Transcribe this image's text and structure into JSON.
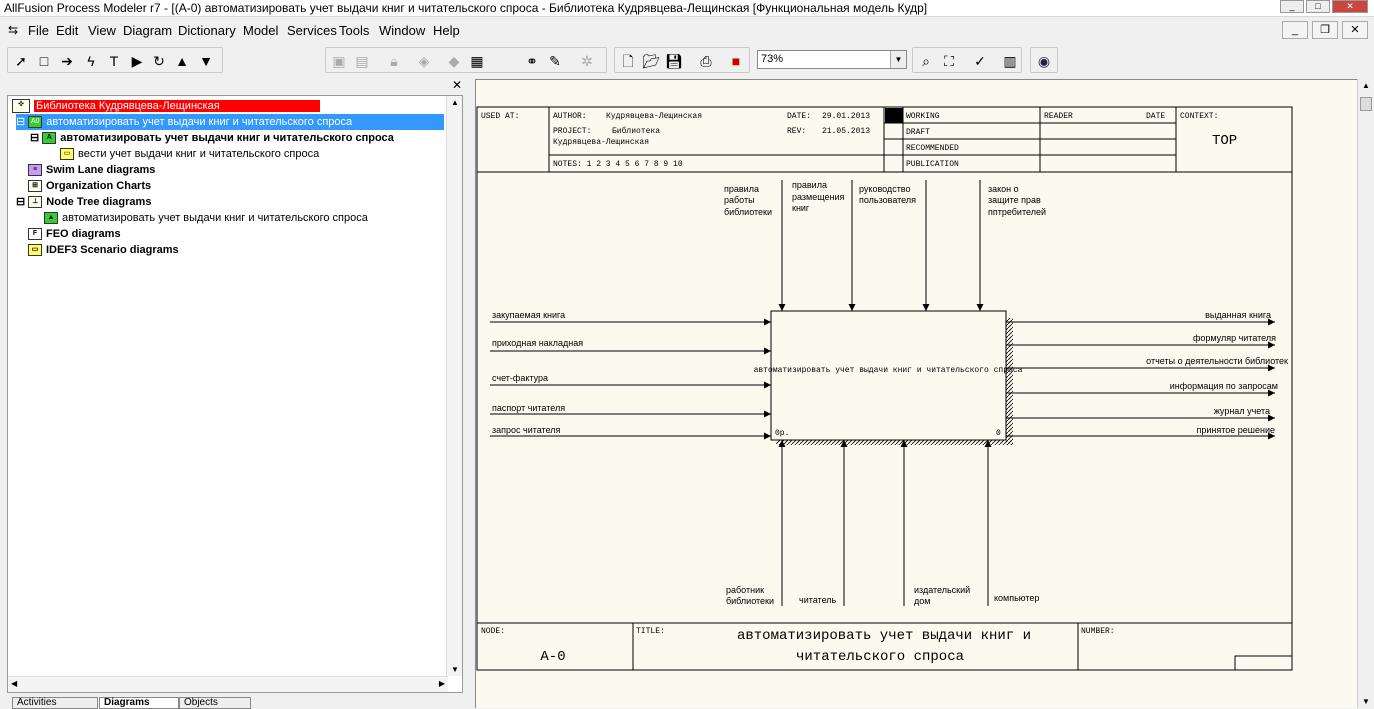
{
  "window": {
    "title": "AllFusion Process Modeler r7 - [(A-0) автоматизировать учет выдачи книг и читательского спроса - Библиотека Кудрявцева-Лещинская  [Функциональная модель Кудр]"
  },
  "menu": [
    "File",
    "Edit",
    "View",
    "Diagram",
    "Dictionary",
    "Model",
    "Services",
    "Tools",
    "Window",
    "Help"
  ],
  "toolbar": {
    "zoom": "73%"
  },
  "tree": {
    "root": "Библиотека Кудрявцева-Лещинская",
    "selected": "автоматизировать учет выдачи книг и читательского спроса",
    "child": "автоматизировать учет выдачи книг и читательского спроса",
    "grandchild": "вести учет выдачи книг и читательского спроса",
    "swim": "Swim Lane diagrams",
    "org": "Organization Charts",
    "node": "Node Tree diagrams",
    "node_child": "автоматизировать учет выдачи книг и читательского спроса",
    "feo": "FEO diagrams",
    "idef3": "IDEF3 Scenario diagrams"
  },
  "tabs": [
    "Activities",
    "Diagrams",
    "Objects"
  ],
  "header": {
    "used_at": "USED AT:",
    "author_label": "AUTHOR:",
    "author": "Кудрявцева-Лещинская",
    "project_label": "PROJECT:",
    "project": "Библиотека",
    "project2": "Кудрявцева-Лещинская",
    "notes": "NOTES:  1  2  3  4  5  6  7  8  9  10",
    "date_label": "DATE:",
    "date": "29.01.2013",
    "rev_label": "REV:",
    "rev": "21.05.2013",
    "working": "WORKING",
    "draft": "DRAFT",
    "recommended": "RECOMMENDED",
    "publication": "PUBLICATION",
    "reader": "READER",
    "reader_date": "DATE",
    "context_label": "CONTEXT:",
    "context": "TOP"
  },
  "diagram": {
    "box_label": "автоматизировать учет выдачи книг и читательского спроса",
    "box_cost": "0р.",
    "box_num": "0",
    "controls": [
      [
        "правила",
        "работы",
        "библиотеки"
      ],
      [
        "правила",
        "размещения",
        "книг"
      ],
      [
        "руководство",
        "пользователя"
      ],
      [
        "закон о",
        "защите прав",
        "пптребителей"
      ]
    ],
    "inputs": [
      "закупаемая книга",
      "приходная накладная",
      "счет-фактура",
      "паспорт читателя",
      "запрос читателя"
    ],
    "outputs": [
      "выданная книга",
      "формуляр читателя",
      "отчеты о деятельности библиотек",
      "информация по запросам",
      "журнал учета",
      "принятое решение"
    ],
    "mechanisms": [
      [
        "работник",
        "библиотеки"
      ],
      [
        "читатель"
      ],
      [
        "издательский",
        "дом"
      ],
      [
        "компьютер"
      ]
    ]
  },
  "footer": {
    "node_label": "NODE:",
    "node": "A-0",
    "title_label": "TITLE:",
    "title1": "автоматизировать учет выдачи книг и",
    "title2": "читательского спроса",
    "number_label": "NUMBER:"
  }
}
